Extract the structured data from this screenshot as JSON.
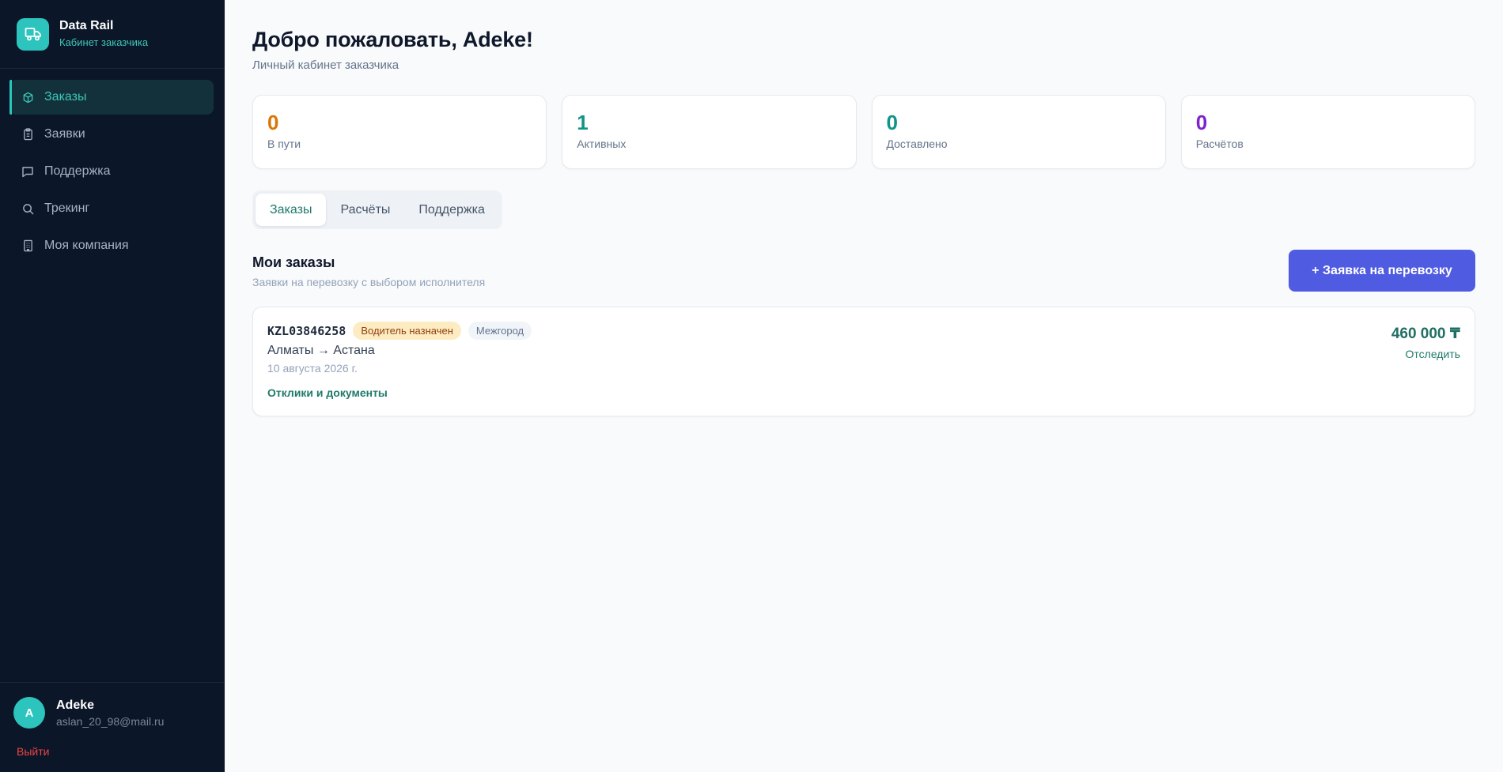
{
  "brand": {
    "name": "Data Rail",
    "subtitle": "Кабинет заказчика",
    "icon": "truck-icon"
  },
  "sidebar": {
    "items": [
      {
        "label": "Заказы",
        "icon": "box-icon",
        "active": true
      },
      {
        "label": "Заявки",
        "icon": "clipboard-icon",
        "active": false
      },
      {
        "label": "Поддержка",
        "icon": "chat-icon",
        "active": false
      },
      {
        "label": "Трекинг",
        "icon": "search-icon",
        "active": false
      },
      {
        "label": "Моя компания",
        "icon": "building-icon",
        "active": false
      }
    ]
  },
  "user": {
    "initial": "A",
    "name": "Adeke",
    "email": "aslan_20_98@mail.ru",
    "logout_label": "Выйти"
  },
  "page": {
    "title": "Добро пожаловать, Adeke!",
    "subtitle": "Личный кабинет заказчика"
  },
  "stats": [
    {
      "value": "0",
      "label": "В пути",
      "color": "#d97706"
    },
    {
      "value": "1",
      "label": "Активных",
      "color": "#0f9488"
    },
    {
      "value": "0",
      "label": "Доставлено",
      "color": "#0f9488"
    },
    {
      "value": "0",
      "label": "Расчётов",
      "color": "#7e22ce"
    }
  ],
  "tabs": [
    {
      "label": "Заказы",
      "active": true
    },
    {
      "label": "Расчёты",
      "active": false
    },
    {
      "label": "Поддержка",
      "active": false
    }
  ],
  "orders_section": {
    "title": "Мои заказы",
    "subtitle": "Заявки на перевозку с выбором исполнителя",
    "new_button_label": "+ Заявка на перевозку"
  },
  "orders": [
    {
      "id": "KZL03846258",
      "status": "Водитель назначен",
      "type": "Межгород",
      "route": "Алматы → Астана",
      "date": "10 августа 2026 г.",
      "link_label": "Отклики и документы",
      "price": "460 000 ₸",
      "track_label": "Отследить"
    }
  ],
  "colors": {
    "sidebar_bg": "#0b1628",
    "accent": "#2cc4bd",
    "primary_button": "#4f5be0"
  }
}
